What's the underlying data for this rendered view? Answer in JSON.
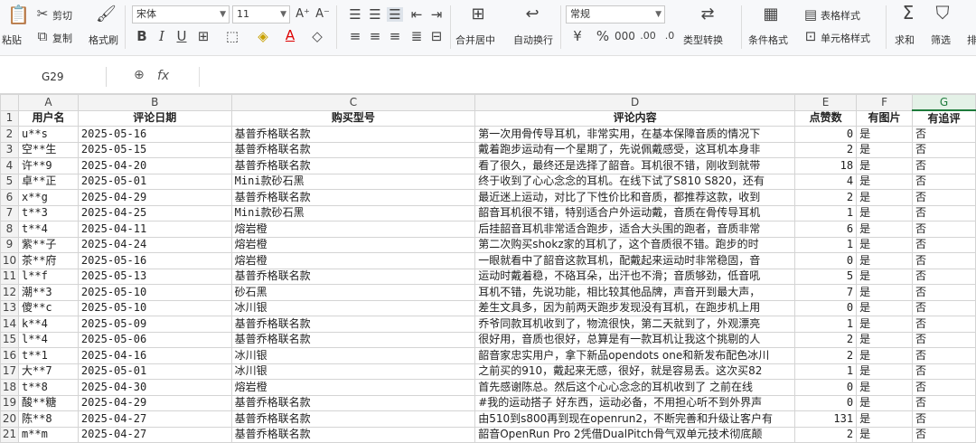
{
  "ribbon": {
    "paste": "粘贴",
    "cut": "剪切",
    "copy": "复制",
    "format_painter": "格式刷",
    "font_name": "宋体",
    "font_size": "11",
    "merge_center": "合并居中",
    "wrap_text": "自动换行",
    "number_format": "常规",
    "type_convert": "类型转换",
    "cond_format": "条件格式",
    "table_style": "表格样式",
    "cell_style": "单元格样式",
    "sum": "求和",
    "filter": "筛选",
    "sort": "排"
  },
  "formula_bar": {
    "cell_ref": "G29",
    "fx": "fx",
    "formula": ""
  },
  "columns": [
    "A",
    "B",
    "C",
    "D",
    "E",
    "F",
    "G"
  ],
  "active_column": "G",
  "headers": [
    "用户名",
    "评论日期",
    "购买型号",
    "评论内容",
    "点赞数",
    "有图片",
    "有追评"
  ],
  "rows": [
    {
      "n": "2",
      "user": "u**s",
      "date": "2025-05-16",
      "model": "基普乔格联名款",
      "comment": "第一次用骨传导耳机，非常实用，在基本保障音质的情况下",
      "likes": "0",
      "pic": "是",
      "follow": "否"
    },
    {
      "n": "3",
      "user": "空**生",
      "date": "2025-05-15",
      "model": "基普乔格联名款",
      "comment": "戴着跑步运动有一个星期了，先说佩戴感受，这耳机本身非",
      "likes": "2",
      "pic": "是",
      "follow": "否"
    },
    {
      "n": "4",
      "user": "许**9",
      "date": "2025-04-20",
      "model": "基普乔格联名款",
      "comment": "看了很久，最终还是选择了韶音。耳机很不错，刚收到就带",
      "likes": "18",
      "pic": "是",
      "follow": "否"
    },
    {
      "n": "5",
      "user": "卓**正",
      "date": "2025-05-01",
      "model": "Mini款砂石黑",
      "comment": "终于收到了心心念念的耳机。在线下试了S810 S820，还有",
      "likes": "4",
      "pic": "是",
      "follow": "否"
    },
    {
      "n": "6",
      "user": "x**g",
      "date": "2025-04-29",
      "model": "基普乔格联名款",
      "comment": "最近迷上运动，对比了下性价比和音质，都推荐这款，收到",
      "likes": "2",
      "pic": "是",
      "follow": "否"
    },
    {
      "n": "7",
      "user": "t**3",
      "date": "2025-04-25",
      "model": "Mini款砂石黑",
      "comment": "韶音耳机很不错，特别适合户外运动戴，音质在骨传导耳机",
      "likes": "1",
      "pic": "是",
      "follow": "否"
    },
    {
      "n": "8",
      "user": "t**4",
      "date": "2025-04-11",
      "model": "熔岩橙",
      "comment": "后挂韶音耳机非常适合跑步，适合大头围的跑者，音质非常",
      "likes": "6",
      "pic": "是",
      "follow": "否"
    },
    {
      "n": "9",
      "user": "紫**子",
      "date": "2025-04-24",
      "model": "熔岩橙",
      "comment": "第二次购买shokz家的耳机了，这个音质很不错。跑步的时",
      "likes": "1",
      "pic": "是",
      "follow": "否"
    },
    {
      "n": "10",
      "user": "茶**府",
      "date": "2025-05-16",
      "model": "熔岩橙",
      "comment": "一眼就看中了韶音这款耳机，配戴起来运动时非常稳固，音",
      "likes": "0",
      "pic": "是",
      "follow": "否"
    },
    {
      "n": "11",
      "user": "l**f",
      "date": "2025-05-13",
      "model": "基普乔格联名款",
      "comment": "运动时戴着稳，不硌耳朵，出汗也不滑；音质够劲，低音吼",
      "likes": "5",
      "pic": "是",
      "follow": "否"
    },
    {
      "n": "12",
      "user": "潮**3",
      "date": "2025-05-10",
      "model": "砂石黑",
      "comment": "耳机不错，先说功能，相比较其他品牌，声音开到最大声，",
      "likes": "7",
      "pic": "是",
      "follow": "否"
    },
    {
      "n": "13",
      "user": "傻**c",
      "date": "2025-05-10",
      "model": "冰川银",
      "comment": "差生文具多，因为前两天跑步发现没有耳机，在跑步机上用",
      "likes": "0",
      "pic": "是",
      "follow": "否"
    },
    {
      "n": "14",
      "user": "k**4",
      "date": "2025-05-09",
      "model": "基普乔格联名款",
      "comment": "乔爷同款耳机收到了，物流很快，第二天就到了，外观漂亮",
      "likes": "1",
      "pic": "是",
      "follow": "否"
    },
    {
      "n": "15",
      "user": "l**4",
      "date": "2025-05-06",
      "model": "基普乔格联名款",
      "comment": "很好用，音质也很好，总算是有一款耳机让我这个挑剔的人",
      "likes": "2",
      "pic": "是",
      "follow": "否"
    },
    {
      "n": "16",
      "user": "t**1",
      "date": "2025-04-16",
      "model": "冰川银",
      "comment": "韶音家忠实用户，拿下新品opendots one和新发布配色冰川",
      "likes": "2",
      "pic": "是",
      "follow": "否"
    },
    {
      "n": "17",
      "user": "大**7",
      "date": "2025-05-01",
      "model": "冰川银",
      "comment": "之前买的910，戴起来无感，很好，就是容易丢。这次买82",
      "likes": "1",
      "pic": "是",
      "follow": "否"
    },
    {
      "n": "18",
      "user": "t**8",
      "date": "2025-04-30",
      "model": "熔岩橙",
      "comment": "首先感谢陈总。然后这个心心念念的耳机收到了 之前在线",
      "likes": "0",
      "pic": "是",
      "follow": "否"
    },
    {
      "n": "19",
      "user": "酸**糖",
      "date": "2025-04-29",
      "model": "基普乔格联名款",
      "comment": "#我的运动搭子 好东西，运动必备，不用担心听不到外界声",
      "likes": "0",
      "pic": "是",
      "follow": "否"
    },
    {
      "n": "20",
      "user": "陈**8",
      "date": "2025-04-27",
      "model": "基普乔格联名款",
      "comment": "由510到s800再到现在openrun2，不断完善和升级让客户有",
      "likes": "131",
      "pic": "是",
      "follow": "否"
    },
    {
      "n": "21",
      "user": "m**m",
      "date": "2025-04-27",
      "model": "基普乔格联名款",
      "comment": "韶音OpenRun Pro 2凭借DualPitch骨气双单元技术彻底颠",
      "likes": "2",
      "pic": "是",
      "follow": "否"
    }
  ]
}
